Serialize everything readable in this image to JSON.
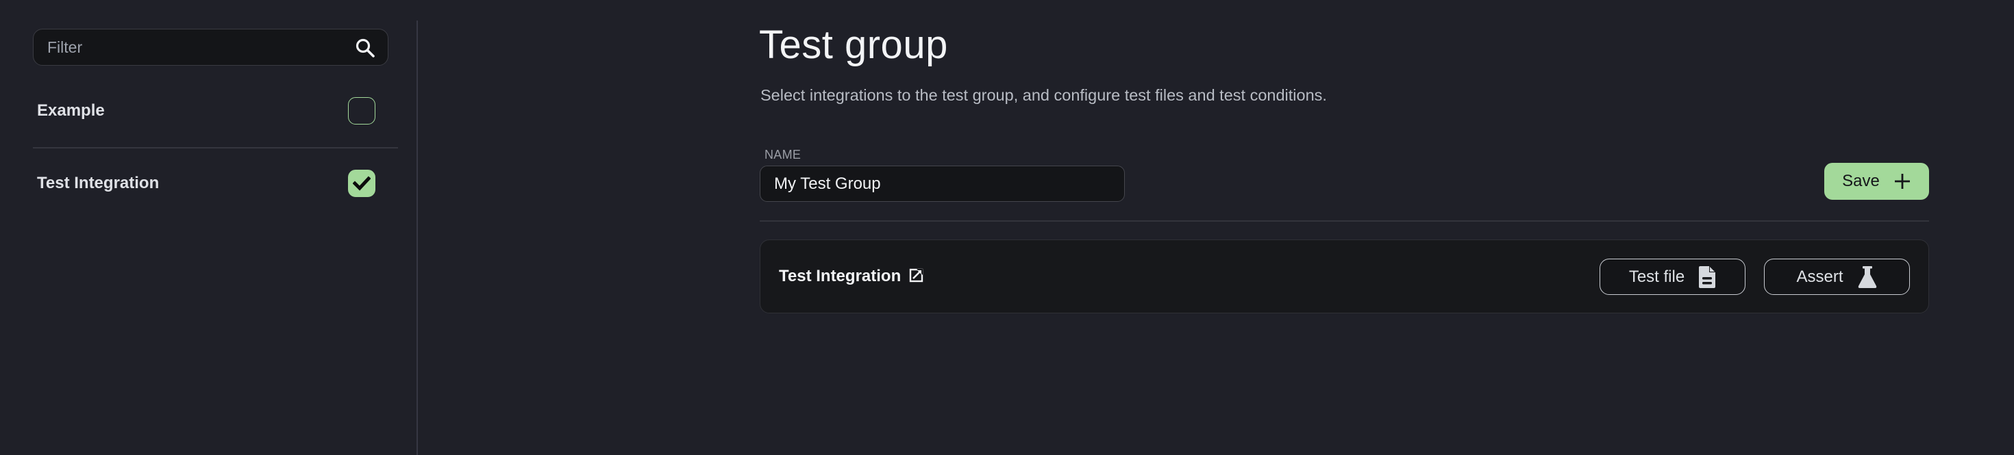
{
  "sidebar": {
    "filter": {
      "placeholder": "Filter",
      "value": "",
      "icon": "search-icon"
    },
    "items": [
      {
        "label": "Example",
        "checked": false
      },
      {
        "label": "Test Integration",
        "checked": true
      }
    ]
  },
  "main": {
    "title": "Test group",
    "subtitle": "Select integrations to the test group, and configure test files and test conditions.",
    "name_field": {
      "label": "NAME",
      "value": "My Test Group"
    },
    "save_button": {
      "label": "Save",
      "icon": "plus-icon"
    },
    "integrations": [
      {
        "name": "Test Integration",
        "link_icon": "external-link-icon",
        "actions": [
          {
            "label": "Test file",
            "icon": "file-icon"
          },
          {
            "label": "Assert",
            "icon": "flask-icon"
          }
        ]
      }
    ]
  },
  "colors": {
    "background": "#1f2028",
    "accent": "#a3d99a",
    "card_background": "#17181b",
    "input_background": "#141518"
  }
}
